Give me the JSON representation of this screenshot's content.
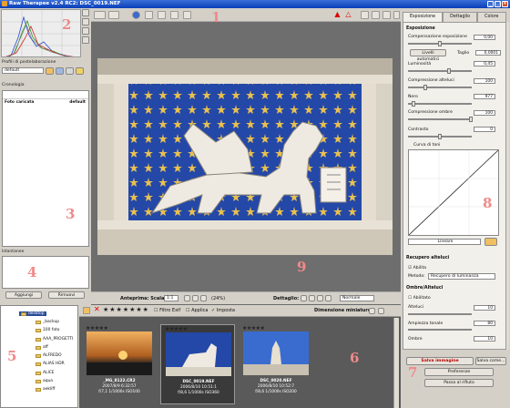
{
  "window": {
    "title": "Raw Therapee v2.4 RC2: DSC_0019.NEF",
    "min": "_",
    "max": "□",
    "close": "×"
  },
  "left": {
    "profile_label": "Profili di postelaborazione",
    "profile_value": "default",
    "history_label": "Cronologia",
    "history_items": [
      {
        "name": "Foto caricata",
        "value": "default"
      }
    ],
    "snapshots_label": "Istantanee",
    "add_label": "Aggiungi",
    "remove_label": "Rimuovi"
  },
  "viewer": {
    "zoom_label": "Anteprima: Scala",
    "zoom_value": "1:1",
    "zoom_pct": "(24%)",
    "details_label": "Dettaglio:",
    "details_value": "Normale"
  },
  "right": {
    "tabs": [
      "Esposizione",
      "Dettaglio",
      "Colore"
    ],
    "exposure_header": "Esposizione",
    "comp_label": "Compensazione esposizione",
    "comp_value": "0,00",
    "auto_label": "Livelli automatici",
    "clip_label": "Taglio",
    "clip_value": "0,0001",
    "lum_label": "Luminosità",
    "lum_value": "0,45",
    "hl_label": "Compressione alteluci",
    "hl_value": "100",
    "black_label": "Nero",
    "black_value": "977",
    "sh_label": "Compressione ombre",
    "sh_value": "100",
    "contrast_label": "Contrasto",
    "contrast_value": "0",
    "curve_label": "Curva di toni",
    "curve_type": "Lineare",
    "recovery_header": "Recupero alteluci",
    "recovery_enable": "Abilita",
    "method_label": "Metodo:",
    "method_value": "Recupero di luminanza",
    "shadows_header": "Ombre/Alteluci",
    "sh_enable": "Abilitato",
    "hl2_label": "Alteluci",
    "hl2_value": "10",
    "tonal_label": "Ampiezza tonale",
    "tonal_value": "80",
    "shadow2_label": "Ombre",
    "shadow2_value": "10",
    "save_label": "Salva immagine",
    "saveas_label": "Salva come...",
    "prefs_label": "Preferenze",
    "queue_label": "Passa al rifiuto"
  },
  "browser": {
    "root": "desktop",
    "folders": [
      "_backup",
      "100 foto",
      "AAA_PROGETTI",
      "aff",
      "ALFREDO",
      "ALIAS HDR",
      "ALICE",
      "aqua",
      "aekliff"
    ],
    "filter_label": "Filtro Exif",
    "apply_label": "Applica",
    "tax_label": "Imposta",
    "size_label": "Dimensione miniature:",
    "thumbs": [
      {
        "name": "_MG_8122.CR2",
        "date": "2007/8/9 6:32:57",
        "exif": "f/7,1 1/1000s ISO100",
        "stars": "★★★★★"
      },
      {
        "name": "DSC_0019.NEF",
        "date": "2006/8/10 10:51:1",
        "exif": "f/8,6 1/1000s ISO360",
        "stars": "★★★★★"
      },
      {
        "name": "DSC_0020.NEF",
        "date": "2006/8/10 10:52:7",
        "exif": "f/8,6 1/1000s ISO200",
        "stars": "★★★★★"
      }
    ]
  },
  "annotations": [
    "1",
    "2",
    "3",
    "4",
    "5",
    "6",
    "7",
    "8",
    "9"
  ]
}
